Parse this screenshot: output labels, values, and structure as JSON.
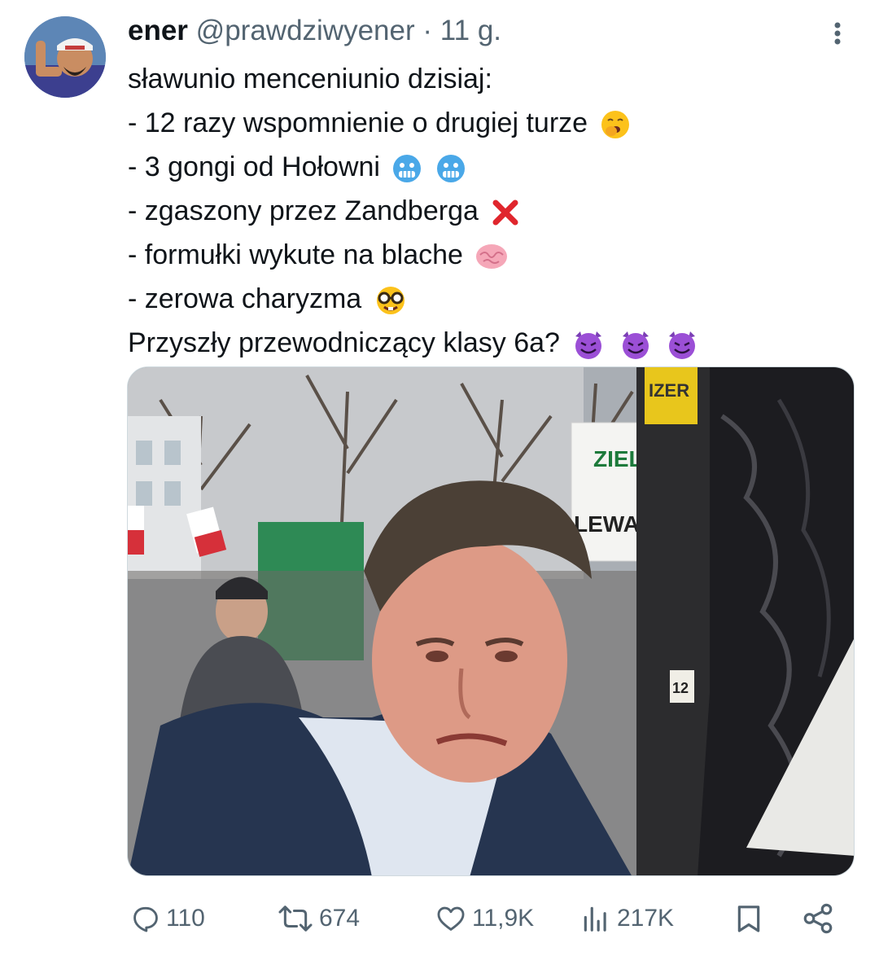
{
  "tweet": {
    "display_name": "ener",
    "handle": "@prawdziwyener",
    "separator": "·",
    "time": "11 g.",
    "lines": [
      {
        "text": "sławunio menceniunio dzisiaj:",
        "emojis": []
      },
      {
        "text": "- 12 razy wspomnienie o drugiej turze",
        "emojis": [
          "yawning-face"
        ]
      },
      {
        "text": "- 3 gongi od Hołowni",
        "emojis": [
          "cold-face",
          "cold-face"
        ]
      },
      {
        "text": "- zgaszony przez Zandberga",
        "emojis": [
          "cross-mark"
        ]
      },
      {
        "text": "- formułki wykute na blache",
        "emojis": [
          "brain"
        ]
      },
      {
        "text": "- zerowa charyzma",
        "emojis": [
          "nerd-face"
        ]
      },
      {
        "text": "Przyszły przewodniczący klasy 6a?",
        "emojis": [
          "smiling-devil",
          "smiling-devil",
          "smiling-devil"
        ]
      }
    ],
    "media": {
      "sign_text_top": "ZIEL",
      "sign_text_bottom": "LEWA",
      "sticker_text": "IZER",
      "pole_number": "12"
    }
  },
  "actions": {
    "reply": {
      "count": "110",
      "icon": "reply-icon"
    },
    "repost": {
      "count": "674",
      "icon": "repost-icon"
    },
    "like": {
      "count": "11,9K",
      "icon": "heart-icon"
    },
    "views": {
      "count": "217K",
      "icon": "views-icon"
    },
    "bookmark": {
      "icon": "bookmark-icon"
    },
    "share": {
      "icon": "share-icon"
    }
  },
  "colors": {
    "text": "#0f1419",
    "muted": "#536471",
    "border": "#cfd9de"
  }
}
